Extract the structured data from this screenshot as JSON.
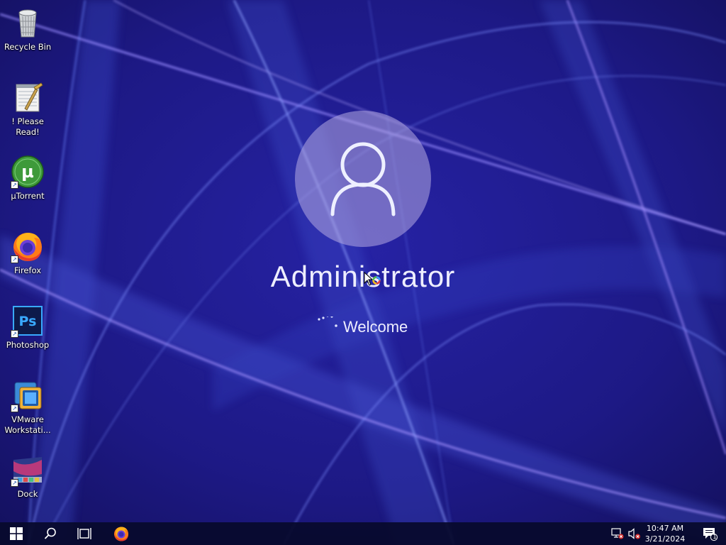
{
  "desktop": {
    "icons": [
      {
        "label": "Recycle Bin",
        "icon": "recycle-bin-icon"
      },
      {
        "label": "! Please Read!",
        "icon": "notepad-icon"
      },
      {
        "label": "µTorrent",
        "icon": "utorrent-icon"
      },
      {
        "label": "Firefox",
        "icon": "firefox-icon"
      },
      {
        "label": "Photoshop",
        "icon": "photoshop-icon",
        "glyph": "Ps"
      },
      {
        "label": "VMware Workstati...",
        "icon": "vmware-icon"
      },
      {
        "label": "Dock",
        "icon": "dock-icon"
      }
    ]
  },
  "login": {
    "user_name": "Administrator",
    "status": "Welcome"
  },
  "taskbar": {
    "buttons": [
      {
        "name": "start-button",
        "icon": "windows-logo-icon"
      },
      {
        "name": "search-button",
        "icon": "search-icon"
      },
      {
        "name": "task-view-button",
        "icon": "task-view-icon"
      },
      {
        "name": "firefox-taskbar-button",
        "icon": "firefox-icon"
      }
    ],
    "tray": {
      "network": "network-disconnected-icon",
      "volume": "volume-muted-icon",
      "time": "10:47 AM",
      "date": "3/21/2024",
      "notifications_count": "1"
    }
  },
  "colors": {
    "background": "#1b1772",
    "taskbar": "#080a2c",
    "text": "#ffffff"
  }
}
